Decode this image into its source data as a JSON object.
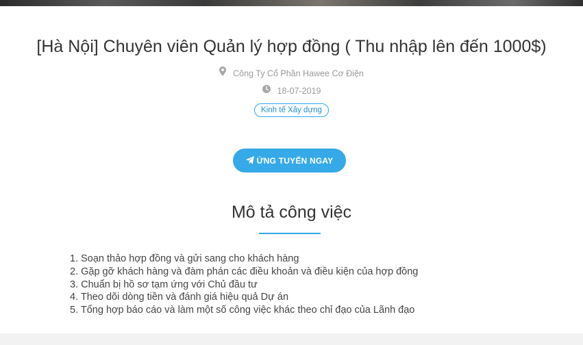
{
  "job": {
    "title": "[Hà Nội] Chuyên viên Quản lý hợp đồng ( Thu nhập lên đến 1000$)",
    "company": "Công Ty Cổ Phần Hawee Cơ Điện",
    "date": "18-07-2019",
    "tag": "Kinh tế Xây dựng",
    "company_icon": "map-marker-icon",
    "date_icon": "clock-icon"
  },
  "apply": {
    "label": "ỨNG TUYỂN NGAY",
    "icon": "paper-plane-icon",
    "color": "#36a9e8"
  },
  "description": {
    "title": "Mô tả công việc",
    "items": [
      "1. Soạn thảo hợp đồng và gửi sang cho khách hàng",
      "2. Gặp gỡ khách hàng và đàm phán các điều khoản và điều kiện của hợp đồng",
      "3. Chuẩn bị hồ sơ tạm ứng với Chủ đầu tư",
      "4. Theo dõi dòng tiền và đánh giá hiệu quả Dự án",
      "5. Tổng hợp báo cáo và làm một số công việc khác theo chỉ đạo của Lãnh đạo"
    ]
  },
  "colors": {
    "accent": "#2fa8e8",
    "muted_text": "#9a9a9a"
  }
}
